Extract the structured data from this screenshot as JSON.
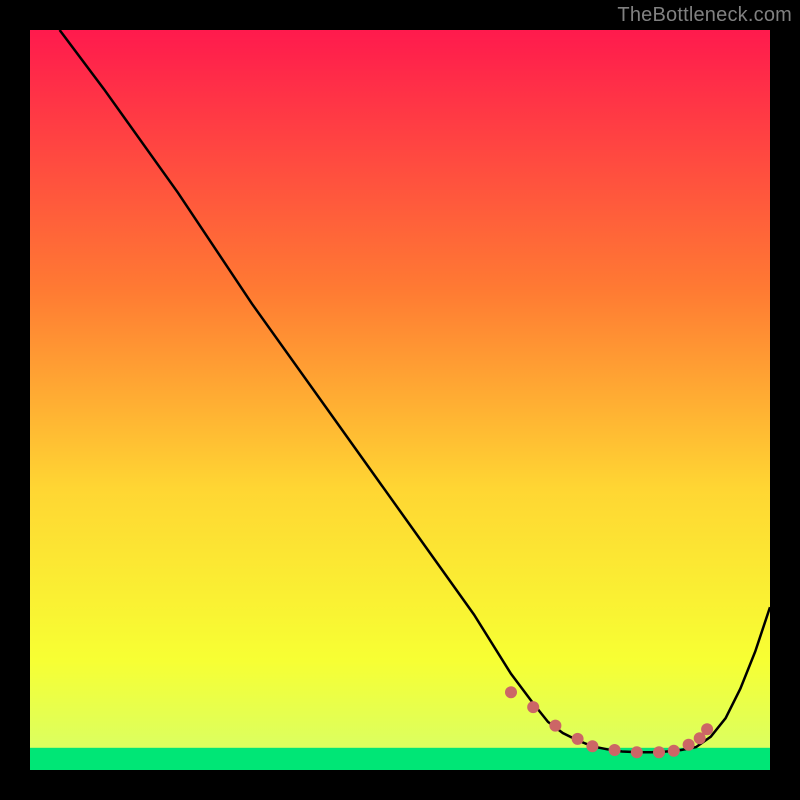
{
  "watermark": "TheBottleneck.com",
  "colors": {
    "black": "#000000",
    "border": "#000000",
    "curve": "#000000",
    "markers": "#cc6666",
    "green": "#00e676",
    "gradient_top": "#ff1a4d",
    "gradient_mid1": "#ff7a33",
    "gradient_mid2": "#ffd633",
    "gradient_mid3": "#f7ff33",
    "gradient_bottom": "#00e676"
  },
  "chart_data": {
    "type": "line",
    "title": "",
    "xlabel": "",
    "ylabel": "",
    "xlim": [
      0,
      100
    ],
    "ylim": [
      0,
      100
    ],
    "series": [
      {
        "name": "curve",
        "x": [
          4,
          10,
          20,
          30,
          40,
          50,
          60,
          65,
          68,
          70,
          72,
          74,
          76,
          78,
          80,
          82,
          84,
          86,
          88,
          90,
          92,
          94,
          96,
          98,
          100
        ],
        "y": [
          100,
          92,
          78,
          63,
          49,
          35,
          21,
          13,
          9,
          6.5,
          5,
          4,
          3.2,
          2.8,
          2.5,
          2.4,
          2.4,
          2.5,
          2.7,
          3.1,
          4.5,
          7,
          11,
          16,
          22
        ]
      }
    ],
    "markers": {
      "x": [
        65,
        68,
        71,
        74,
        76,
        79,
        82,
        85,
        87,
        89,
        90.5,
        91.5
      ],
      "y": [
        10.5,
        8.5,
        6,
        4.2,
        3.2,
        2.7,
        2.4,
        2.4,
        2.6,
        3.4,
        4.3,
        5.5
      ]
    },
    "green_band_y": [
      0,
      3
    ]
  }
}
